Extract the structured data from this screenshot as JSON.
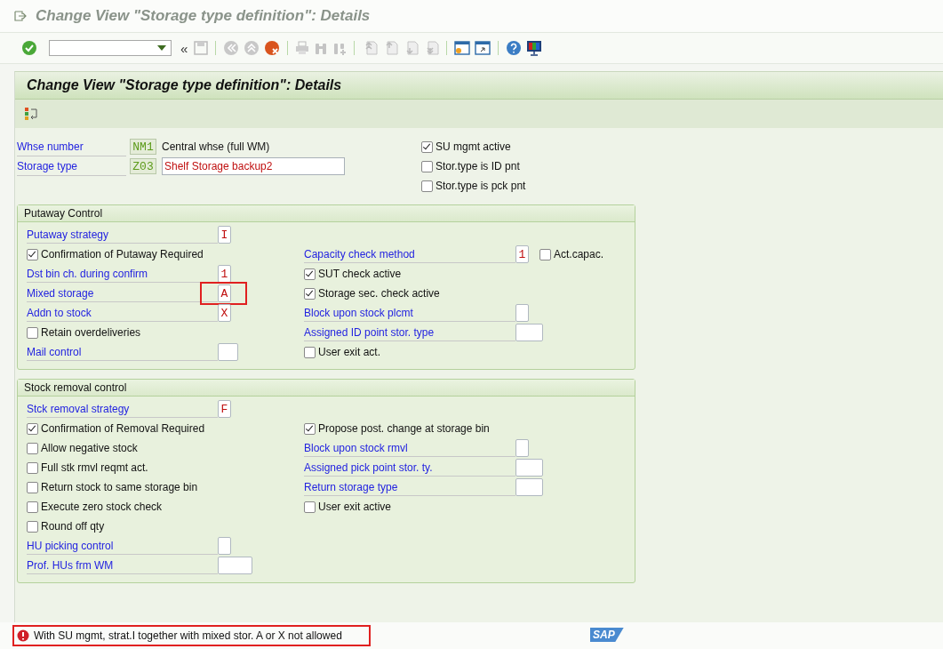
{
  "window": {
    "title": "Change View \"Storage type definition\": Details"
  },
  "toolbar": {
    "collapse": "«"
  },
  "screen_title": "Change View \"Storage type definition\": Details",
  "header": {
    "fields": [
      {
        "label": "Whse number",
        "value": "NM1",
        "description": {
          "kind": "text",
          "text": "Central whse (full WM)"
        }
      },
      {
        "label": "Storage type",
        "value": "Z03",
        "description": {
          "kind": "input",
          "text": "Shelf Storage backup2"
        }
      }
    ],
    "flags": [
      {
        "label": "SU mgmt active",
        "checked": true
      },
      {
        "label": "Stor.type is ID pnt",
        "checked": false
      },
      {
        "label": "Stor.type is pck pnt",
        "checked": false
      }
    ]
  },
  "groups": [
    {
      "title": "Putaway Control",
      "rows": [
        {
          "left": {
            "kind": "short_field",
            "label": "Putaway strategy",
            "value": "I",
            "highlighted": false
          }
        },
        {
          "left": {
            "kind": "checkbox",
            "label": "Confirmation of Putaway Required",
            "checked": true
          },
          "right": {
            "kind": "short_field",
            "label": "Capacity check method",
            "value": "1",
            "highlighted": false,
            "checkbox": {
              "label": "Act.capac.",
              "checked": false
            }
          }
        },
        {
          "left": {
            "kind": "short_field",
            "label": "Dst bin ch. during confirm",
            "value": "1",
            "highlighted": false
          },
          "right": {
            "kind": "checkbox",
            "label": "SUT check active",
            "checked": true
          }
        },
        {
          "left": {
            "kind": "short_field",
            "label": "Mixed storage",
            "value": "A",
            "highlighted": true
          },
          "right": {
            "kind": "checkbox",
            "label": "Storage sec. check active",
            "checked": true
          }
        },
        {
          "left": {
            "kind": "short_field",
            "label": "Addn to stock",
            "value": "X",
            "highlighted": false
          },
          "right": {
            "kind": "short_field",
            "label": "Block upon stock plcmt",
            "highlighted": false
          }
        },
        {
          "left": {
            "kind": "checkbox",
            "label": "Retain overdeliveries",
            "checked": false
          },
          "right": {
            "kind": "medium_field",
            "label": "Assigned ID point stor. type",
            "highlighted": false
          }
        },
        {
          "left": {
            "kind": "medium_field",
            "label": "Mail control",
            "highlighted": false
          },
          "right": {
            "kind": "checkbox",
            "label": "User exit act.",
            "checked": false
          }
        }
      ]
    },
    {
      "title": "Stock removal control",
      "rows": [
        {
          "left": {
            "kind": "short_field",
            "label": "Stck removal strategy",
            "value": "F",
            "highlighted": false
          }
        },
        {
          "left": {
            "kind": "checkbox",
            "label": "Confirmation of Removal Required",
            "checked": true
          },
          "right": {
            "kind": "checkbox",
            "label": "Propose post. change at storage bin",
            "checked": true
          }
        },
        {
          "left": {
            "kind": "checkbox",
            "label": "Allow negative stock",
            "checked": false
          },
          "right": {
            "kind": "short_field",
            "label": "Block upon stock rmvl",
            "highlighted": false
          }
        },
        {
          "left": {
            "kind": "checkbox",
            "label": "Full stk rmvl reqmt act.",
            "checked": false
          },
          "right": {
            "kind": "medium_field",
            "label": "Assigned pick point stor. ty.",
            "highlighted": false
          }
        },
        {
          "left": {
            "kind": "checkbox",
            "label": "Return stock to same storage bin",
            "checked": false
          },
          "right": {
            "kind": "medium_field",
            "label": "Return storage type",
            "highlighted": false
          }
        },
        {
          "left": {
            "kind": "checkbox",
            "label": "Execute zero stock check",
            "checked": false
          },
          "right": {
            "kind": "checkbox",
            "label": "User exit active",
            "checked": false
          }
        },
        {
          "left": {
            "kind": "checkbox",
            "label": "Round off qty",
            "checked": false
          }
        },
        {
          "left": {
            "kind": "short_field",
            "label": "HU picking control",
            "highlighted": false
          }
        },
        {
          "left": {
            "kind": "long_field",
            "label": "Prof. HUs frm WM",
            "highlighted": false
          }
        }
      ]
    }
  ],
  "status_bar": {
    "kind": "error",
    "text": "With SU mgmt, strat.I together with mixed stor. A or X not allowed",
    "highlighted": true
  },
  "logo": "SAP"
}
